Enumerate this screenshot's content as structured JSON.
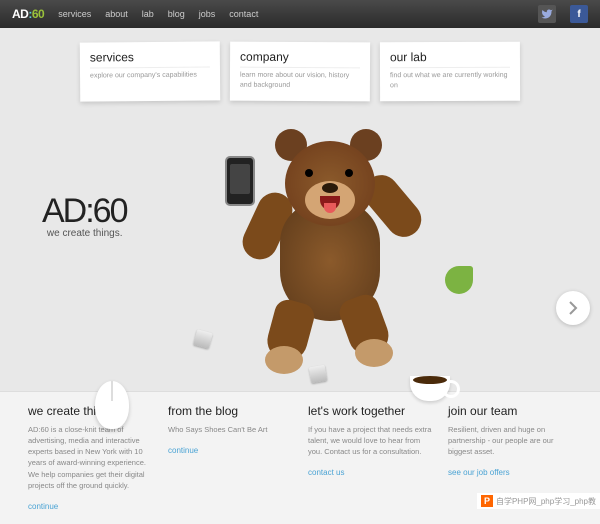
{
  "nav": {
    "logo": {
      "ad": "AD",
      "colon": ":",
      "sixty": "60"
    },
    "items": [
      "services",
      "about",
      "lab",
      "blog",
      "jobs",
      "contact"
    ]
  },
  "cards": [
    {
      "title": "services",
      "desc": "explore our company's capabilities"
    },
    {
      "title": "company",
      "desc": "learn more about our vision, history and background"
    },
    {
      "title": "our lab",
      "desc": "find out what we are currently working on"
    }
  ],
  "hero": {
    "logo_line": "AD:60",
    "tagline": "we create things."
  },
  "columns": [
    {
      "heading": "we create things",
      "body": "AD:60 is a close-knit team of advertising, media and interactive experts based in New York with 10 years of award-winning experience. We help companies get their digital projects off the ground quickly.",
      "link": "continue"
    },
    {
      "heading": "from the blog",
      "body": "Who Says Shoes Can't Be Art",
      "link": "continue"
    },
    {
      "heading": "let's work together",
      "body": "If you have a project that needs extra talent, we would love to hear from you. Contact us for a consultation.",
      "link": "contact us"
    },
    {
      "heading": "join our team",
      "body": "Resilient, driven and huge on partnership - our people are our biggest asset.",
      "link": "see our job offers"
    }
  ],
  "watermark": {
    "badge": "P",
    "text": "自学PHP网_php学习_php教"
  }
}
